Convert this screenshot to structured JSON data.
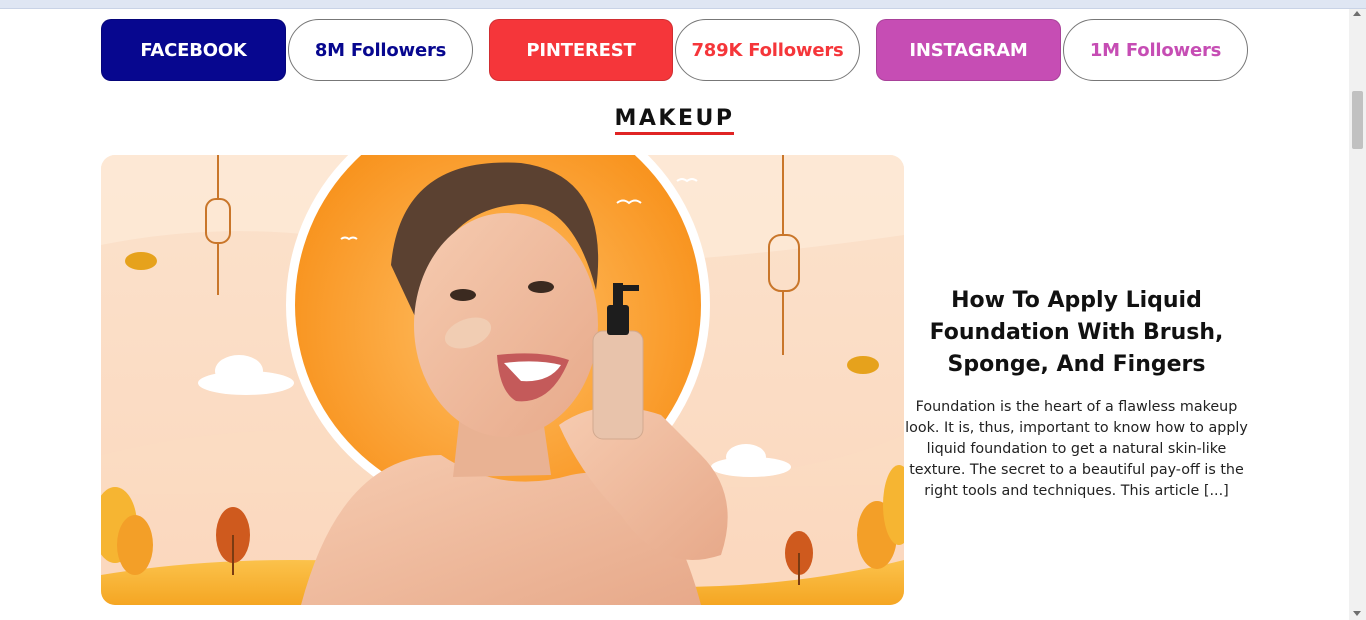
{
  "social": {
    "facebook": {
      "name": "FACEBOOK",
      "followers": "8M Followers",
      "color": "#07078f"
    },
    "pinterest": {
      "name": "PINTEREST",
      "followers": "789K Followers",
      "color": "#f5363a"
    },
    "instagram": {
      "name": "INSTAGRAM",
      "followers": "1M Followers",
      "color": "#c64db4"
    }
  },
  "section": {
    "title": "MAKEUP",
    "underline_color": "#e02424"
  },
  "article": {
    "title": "How To Apply Liquid Foundation With Brush, Sponge, And Fingers",
    "excerpt": "Foundation is the heart of a flawless makeup look. It is, thus, important to know how to apply liquid foundation to get a natural skin-like texture. The secret to a beautiful pay-off is the right tools and techniques. This article [...]"
  }
}
